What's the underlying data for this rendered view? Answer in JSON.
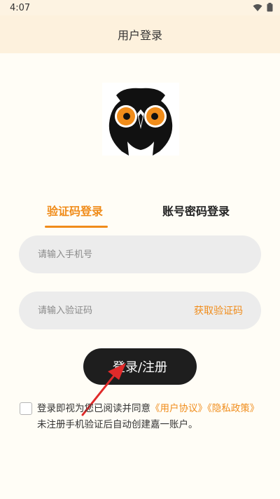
{
  "status_bar": {
    "time": "4:07"
  },
  "header": {
    "title": "用户登录"
  },
  "tabs": [
    {
      "label": "验证码登录"
    },
    {
      "label": "账号密码登录"
    }
  ],
  "phone_field": {
    "placeholder": "请输入手机号"
  },
  "code_field": {
    "placeholder": "请输入验证码",
    "get_code_label": "获取验证码"
  },
  "login_button": {
    "label": "登录/注册"
  },
  "agreement": {
    "prefix": "登录即视为您已阅读并同意",
    "user_agreement": "《用户协议》",
    "privacy_policy": "《隐私政策》",
    "suffix": "未注册手机验证后自动创建嘉一账户。"
  },
  "colors": {
    "accent": "#f08c1a",
    "header_bg": "#fdf1dd",
    "button_bg": "#1e1e1e",
    "arrow": "#e02a2a"
  },
  "icons": {
    "logo": "owl-logo-icon",
    "arrow": "red-arrow-icon"
  }
}
